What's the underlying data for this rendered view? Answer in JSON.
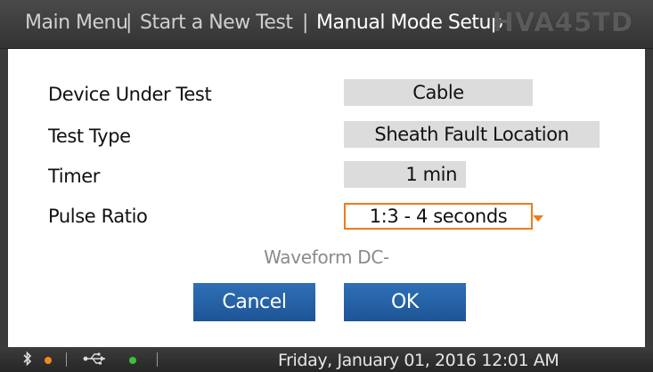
{
  "breadcrumb": {
    "items": [
      "Main Menu",
      "Start a New Test",
      "Manual Mode Setup"
    ],
    "separator": "|"
  },
  "brand": "HVA45TD",
  "form": {
    "device_under_test": {
      "label": "Device Under Test",
      "value": "Cable"
    },
    "test_type": {
      "label": "Test Type",
      "value": "Sheath Fault Location"
    },
    "timer": {
      "label": "Timer",
      "value": "1 min"
    },
    "pulse_ratio": {
      "label": "Pulse Ratio",
      "value": "1:3 - 4 seconds"
    }
  },
  "waveform_text": "Waveform DC-",
  "buttons": {
    "cancel": "Cancel",
    "ok": "OK"
  },
  "statusbar": {
    "datetime": "Friday, January 01, 2016 12:01 AM",
    "icons": [
      "bluetooth-icon",
      "usb-icon"
    ],
    "bluetooth_dot_color": "#f08a1c",
    "usb_dot_color": "#3fbf3a"
  },
  "colors": {
    "accent_orange": "#f07a1a",
    "button_blue": "#1d5596",
    "field_gray": "#dcdcdc"
  }
}
